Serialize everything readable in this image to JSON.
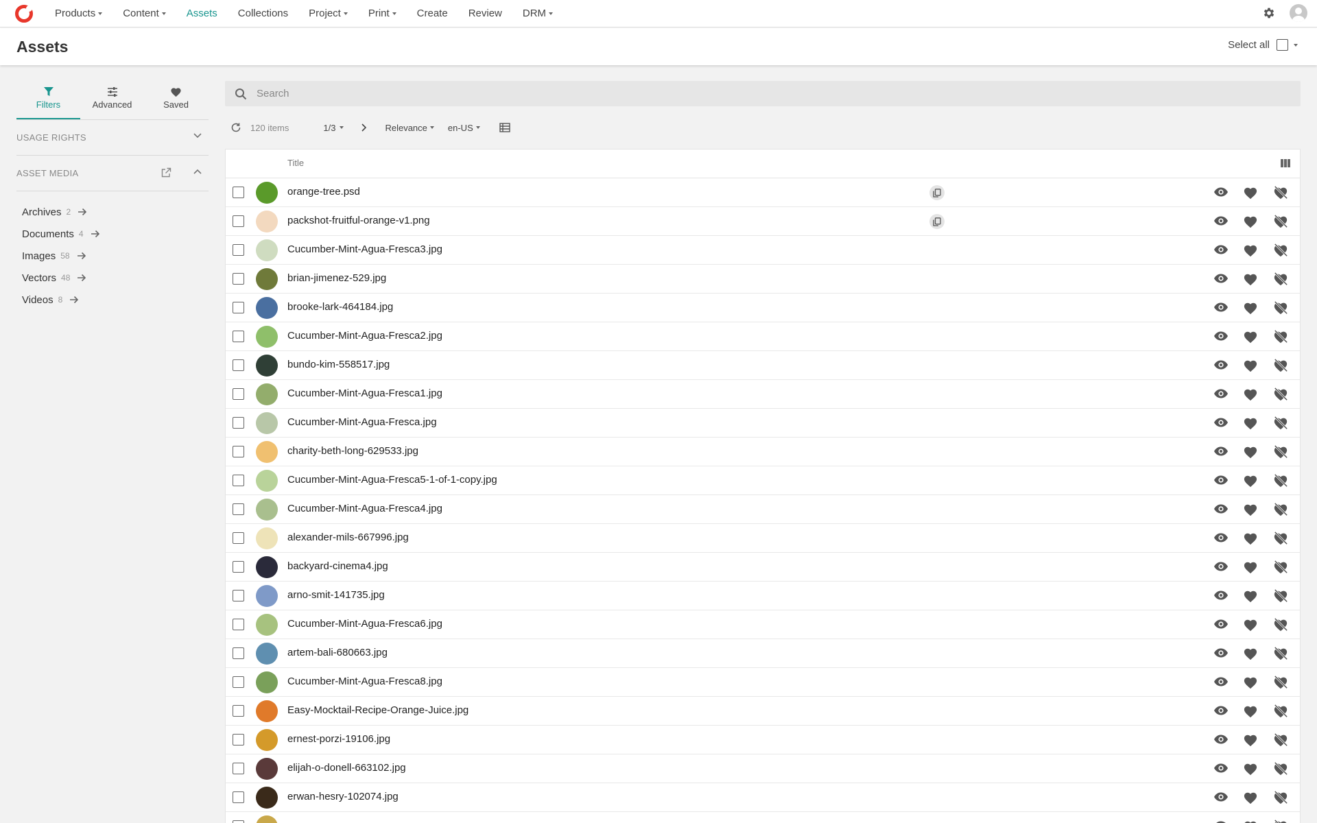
{
  "nav": {
    "items": [
      {
        "label": "Products",
        "dropdown": true,
        "active": false
      },
      {
        "label": "Content",
        "dropdown": true,
        "active": false
      },
      {
        "label": "Assets",
        "dropdown": false,
        "active": true
      },
      {
        "label": "Collections",
        "dropdown": false,
        "active": false
      },
      {
        "label": "Project",
        "dropdown": true,
        "active": false
      },
      {
        "label": "Print",
        "dropdown": true,
        "active": false
      },
      {
        "label": "Create",
        "dropdown": false,
        "active": false
      },
      {
        "label": "Review",
        "dropdown": false,
        "active": false
      },
      {
        "label": "DRM",
        "dropdown": true,
        "active": false
      }
    ]
  },
  "header": {
    "title": "Assets",
    "select_all": "Select all"
  },
  "sidebar": {
    "tabs": [
      {
        "label": "Filters",
        "icon": "filter-icon",
        "active": true
      },
      {
        "label": "Advanced",
        "icon": "sliders-icon",
        "active": false
      },
      {
        "label": "Saved",
        "icon": "heart-icon",
        "active": false
      }
    ],
    "sections": {
      "usage_rights": "USAGE RIGHTS",
      "asset_media": "ASSET MEDIA"
    },
    "media": [
      {
        "label": "Archives",
        "count": "2"
      },
      {
        "label": "Documents",
        "count": "4"
      },
      {
        "label": "Images",
        "count": "58"
      },
      {
        "label": "Vectors",
        "count": "48"
      },
      {
        "label": "Videos",
        "count": "8"
      }
    ]
  },
  "search": {
    "placeholder": "Search",
    "value": ""
  },
  "toolbar": {
    "items_count": "120 items",
    "page": "1/3",
    "sort": "Relevance",
    "locale": "en-US"
  },
  "table": {
    "header_title": "Title",
    "rows": [
      {
        "name": "orange-tree.psd",
        "copy": true,
        "thumb": "#5a9a2a"
      },
      {
        "name": "packshot-fruitful-orange-v1.png",
        "copy": true,
        "thumb": "#f3d9bf"
      },
      {
        "name": "Cucumber-Mint-Agua-Fresca3.jpg",
        "copy": false,
        "thumb": "#cfdcc0"
      },
      {
        "name": "brian-jimenez-529.jpg",
        "copy": false,
        "thumb": "#6f7a3a"
      },
      {
        "name": "brooke-lark-464184.jpg",
        "copy": false,
        "thumb": "#4a6fa0"
      },
      {
        "name": "Cucumber-Mint-Agua-Fresca2.jpg",
        "copy": false,
        "thumb": "#8fbf6a"
      },
      {
        "name": "bundo-kim-558517.jpg",
        "copy": false,
        "thumb": "#2f3f36"
      },
      {
        "name": "Cucumber-Mint-Agua-Fresca1.jpg",
        "copy": false,
        "thumb": "#93ad6c"
      },
      {
        "name": "Cucumber-Mint-Agua-Fresca.jpg",
        "copy": false,
        "thumb": "#b8c7a8"
      },
      {
        "name": "charity-beth-long-629533.jpg",
        "copy": false,
        "thumb": "#f0c070"
      },
      {
        "name": "Cucumber-Mint-Agua-Fresca5-1-of-1-copy.jpg",
        "copy": false,
        "thumb": "#b9d39a"
      },
      {
        "name": "Cucumber-Mint-Agua-Fresca4.jpg",
        "copy": false,
        "thumb": "#a9bf8e"
      },
      {
        "name": "alexander-mils-667996.jpg",
        "copy": false,
        "thumb": "#eee3b8"
      },
      {
        "name": "backyard-cinema4.jpg",
        "copy": false,
        "thumb": "#2a2a3a"
      },
      {
        "name": "arno-smit-141735.jpg",
        "copy": false,
        "thumb": "#7f9ac8"
      },
      {
        "name": "Cucumber-Mint-Agua-Fresca6.jpg",
        "copy": false,
        "thumb": "#a7c27f"
      },
      {
        "name": "artem-bali-680663.jpg",
        "copy": false,
        "thumb": "#5f8fb0"
      },
      {
        "name": "Cucumber-Mint-Agua-Fresca8.jpg",
        "copy": false,
        "thumb": "#7aa05a"
      },
      {
        "name": "Easy-Mocktail-Recipe-Orange-Juice.jpg",
        "copy": false,
        "thumb": "#e07a2a"
      },
      {
        "name": "ernest-porzi-19106.jpg",
        "copy": false,
        "thumb": "#d49a2a"
      },
      {
        "name": "elijah-o-donell-663102.jpg",
        "copy": false,
        "thumb": "#5a3a3a"
      },
      {
        "name": "erwan-hesry-102074.jpg",
        "copy": false,
        "thumb": "#3a2a1a"
      },
      {
        "name": "",
        "copy": false,
        "thumb": "#c9a84a"
      }
    ]
  },
  "colors": {
    "accent": "#18958e",
    "brand": "#e8372b",
    "icon": "#555555"
  }
}
